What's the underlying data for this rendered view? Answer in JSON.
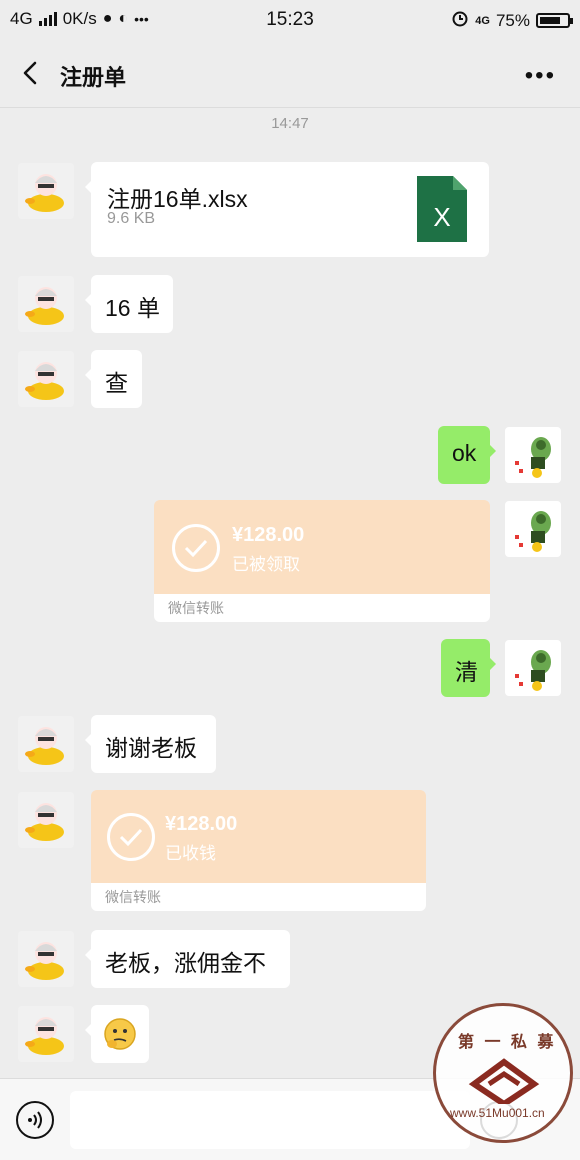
{
  "status_bar": {
    "network": "4G",
    "speed": "0K/s",
    "time": "15:23",
    "signal_right": "4G",
    "battery_percent": "75%",
    "battery_level": 0.75
  },
  "nav": {
    "title": "注册单"
  },
  "chat": {
    "timestamp": "14:47",
    "file_message": {
      "name": "注册16单.xlsx",
      "size": "9.6 KB",
      "icon_letter": "X"
    },
    "msg_16": "16 单",
    "msg_cha": "查",
    "msg_ok": "ok",
    "transfer_out": {
      "amount": "¥128.00",
      "status": "已被领取",
      "label": "微信转账"
    },
    "msg_qing": "清",
    "msg_thanks": "谢谢老板",
    "transfer_in": {
      "amount": "¥128.00",
      "status": "已收钱",
      "label": "微信转账"
    },
    "msg_raise": "老板，涨佣金不"
  },
  "watermark": {
    "top_text": "第 一 私 募",
    "bottom_text": "www.51Mu001.cn"
  },
  "colors": {
    "background": "#ededed",
    "green_bubble": "#95ec69",
    "transfer_orange": "#fbdfc2",
    "excel_green": "#1e7145"
  }
}
